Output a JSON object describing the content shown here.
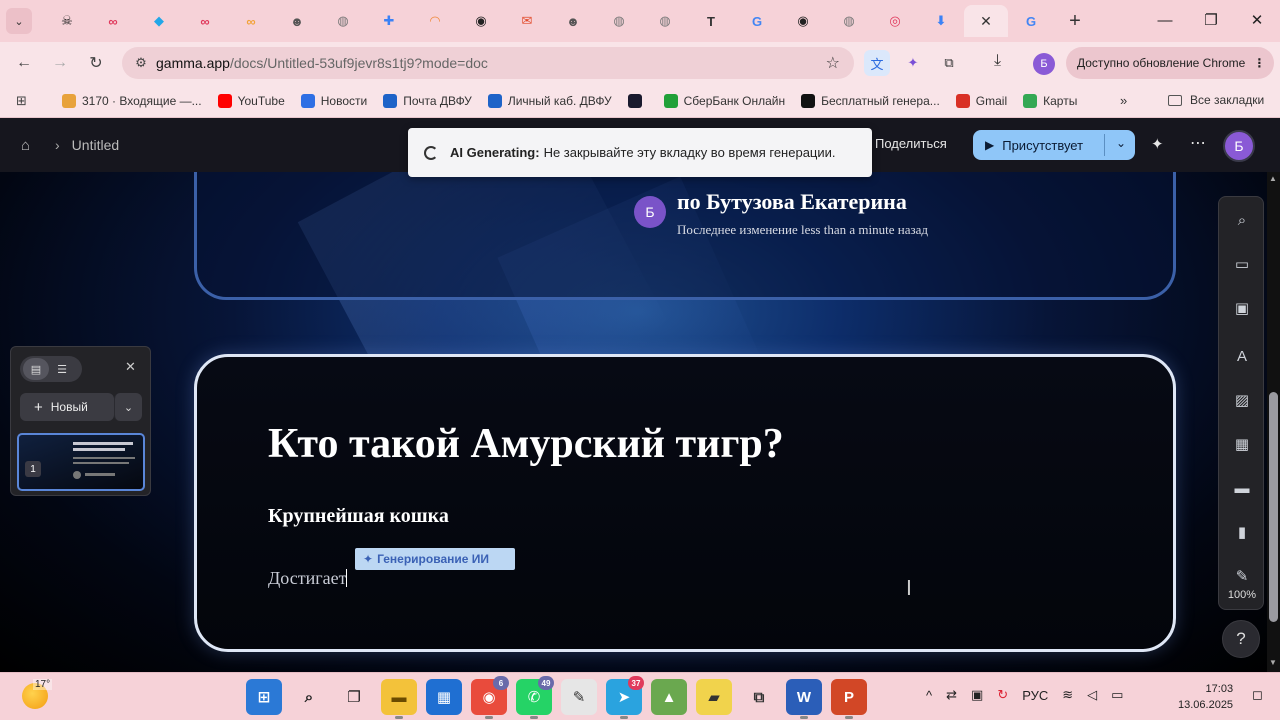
{
  "browser": {
    "tabs": [
      {
        "icon": "skull-icon",
        "glyph": "☠",
        "color": "#222222"
      },
      {
        "icon": "infinity-icon",
        "glyph": "∞",
        "color": "#e0395c"
      },
      {
        "icon": "ai-assistant-icon",
        "glyph": "◆",
        "color": "#22a7e8"
      },
      {
        "icon": "infinity-icon",
        "glyph": "∞",
        "color": "#e0395c"
      },
      {
        "icon": "infinity-icon",
        "glyph": "∞",
        "color": "#f2a33a"
      },
      {
        "icon": "mascot-icon",
        "glyph": "☻",
        "color": "#555555"
      },
      {
        "icon": "globe-icon",
        "glyph": "◍",
        "color": "#777777"
      },
      {
        "icon": "puzzle-icon",
        "glyph": "✚",
        "color": "#3b82f6"
      },
      {
        "icon": "rainbow-icon",
        "glyph": "◠",
        "color": "#f08a3c"
      },
      {
        "icon": "chat-icon",
        "glyph": "◉",
        "color": "#222222"
      },
      {
        "icon": "mail-icon",
        "glyph": "✉",
        "color": "#e24a2a"
      },
      {
        "icon": "mascot-icon",
        "glyph": "☻",
        "color": "#555555"
      },
      {
        "icon": "globe-icon",
        "glyph": "◍",
        "color": "#777777"
      },
      {
        "icon": "globe-icon",
        "glyph": "◍",
        "color": "#777777"
      },
      {
        "icon": "text-icon",
        "glyph": "T",
        "color": "#333333"
      },
      {
        "icon": "google-icon",
        "glyph": "G",
        "color": "#4285f4"
      },
      {
        "icon": "chat-icon",
        "glyph": "◉",
        "color": "#222222"
      },
      {
        "icon": "globe-icon",
        "glyph": "◍",
        "color": "#777777"
      },
      {
        "icon": "record-icon",
        "glyph": "◎",
        "color": "#e0395c"
      },
      {
        "icon": "download-icon",
        "glyph": "⬇",
        "color": "#3b82f6"
      },
      {
        "icon": "close-icon",
        "glyph": "✕",
        "color": "#333333",
        "active": true
      },
      {
        "icon": "google-icon",
        "glyph": "G",
        "color": "#4285f4"
      }
    ],
    "url_host": "gamma.app",
    "url_path": "/docs/Untitled-53uf9jevr8s1tj9?mode=doc",
    "profile_initial": "Б",
    "update_label": "Доступно обновление Chrome",
    "bookmarks": [
      {
        "label": "3170 · Входящие —...",
        "color": "#e8a23b"
      },
      {
        "label": "YouTube",
        "color": "#ff0000"
      },
      {
        "label": "Новости",
        "color": "#2f6fe4"
      },
      {
        "label": "Почта ДВФУ",
        "color": "#1e63c8"
      },
      {
        "label": "Личный каб. ДВФУ",
        "color": "#1e63c8"
      },
      {
        "label": "",
        "color": "#1a1a2e"
      },
      {
        "label": "СберБанк Онлайн",
        "color": "#21a038"
      },
      {
        "label": "Бесплатный генера...",
        "color": "#111111"
      },
      {
        "label": "Gmail",
        "color": "#d93025"
      },
      {
        "label": "Карты",
        "color": "#34a853"
      }
    ],
    "all_bookmarks": "Все закладки"
  },
  "gamma": {
    "doc_title": "Untitled",
    "share_label": "Поделиться",
    "present_label": "Присутствует",
    "avatar_initial": "Б",
    "toast_bold": "AI Generating:",
    "toast_text": "Не закрывайте эту вкладку во время генерации."
  },
  "canvas": {
    "author_initial": "Б",
    "author_name": "по Бутузова Екатерина",
    "author_meta": "Последнее изменение less than a minute назад",
    "slide_title": "Кто такой Амурский тигр?",
    "slide_subtitle": "Крупнейшая кошка",
    "slide_body": "Достигает",
    "ai_tag": "Генерирование ИИ"
  },
  "left_panel": {
    "new_label": "Новый",
    "card_number": "1"
  },
  "right_toolbar": {
    "zoom": "100%",
    "help": "?"
  },
  "taskbar": {
    "temperature": "17°",
    "lang": "РУС",
    "time": "17:03",
    "date": "13.06.2025",
    "badges": {
      "chrome": "6",
      "whatsapp": "49",
      "telegram": "37"
    }
  }
}
